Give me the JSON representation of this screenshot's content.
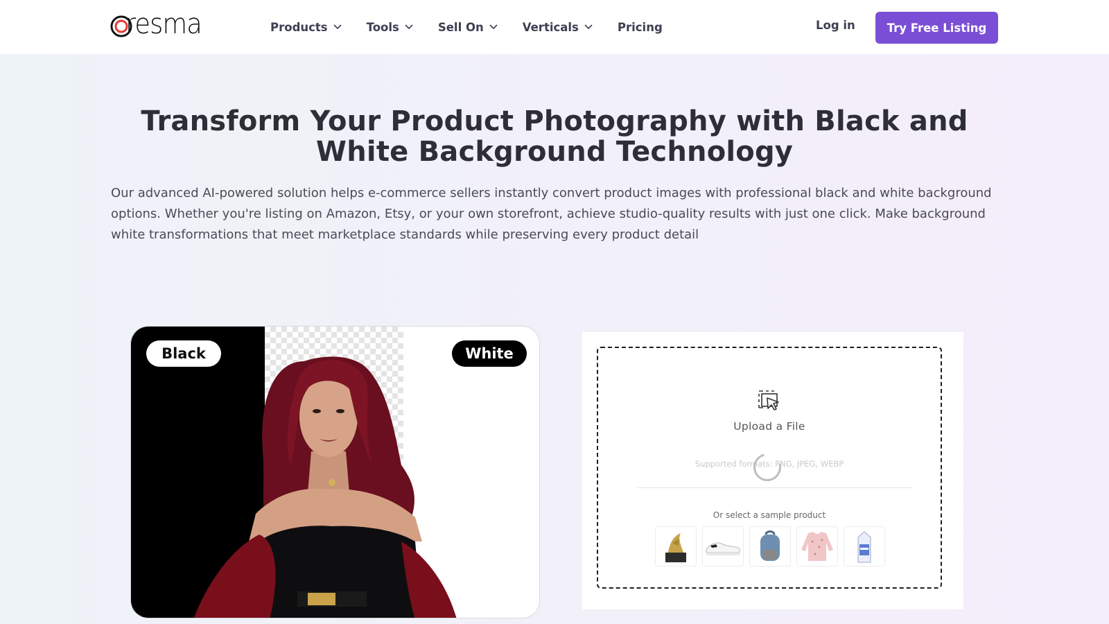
{
  "header": {
    "logo_text": "resma",
    "nav": [
      {
        "label": "Products",
        "has_dropdown": true
      },
      {
        "label": "Tools",
        "has_dropdown": true
      },
      {
        "label": "Sell On",
        "has_dropdown": true
      },
      {
        "label": "Verticals",
        "has_dropdown": true
      },
      {
        "label": "Pricing",
        "has_dropdown": false
      }
    ],
    "login_label": "Log in",
    "cta_label": "Try Free Listing",
    "cta_color": "#7a4fd6"
  },
  "hero": {
    "title": "Transform Your Product Photography with Black and White Background Technology",
    "description": "Our advanced AI-powered solution helps e-commerce sellers instantly convert product images with professional black and white background options. Whether you're listing on Amazon, Etsy, or your own storefront, achieve studio-quality results with just one click. Make background white transformations that meet marketplace standards while preserving every product detail"
  },
  "compare": {
    "left_label": "Black",
    "right_label": "White"
  },
  "upload": {
    "title": "Upload a File",
    "formats": "Supported formats: PNG, JPEG, WEBP",
    "sample_label": "Or select a sample product",
    "samples": [
      {
        "icon": "trophy-icon"
      },
      {
        "icon": "sneaker-icon"
      },
      {
        "icon": "backpack-icon"
      },
      {
        "icon": "sweater-icon"
      },
      {
        "icon": "milk-carton-icon"
      }
    ]
  }
}
